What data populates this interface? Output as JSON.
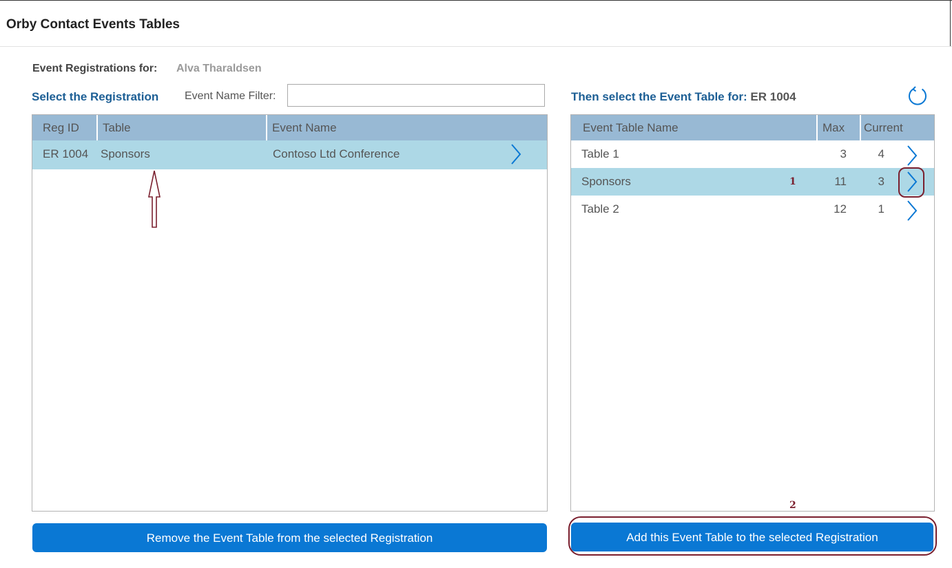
{
  "app": {
    "title": "Orby Contact Events Tables"
  },
  "registration_for": {
    "label": "Event Registrations for:",
    "contact_name": "Alva Tharaldsen"
  },
  "left_panel": {
    "heading": "Select the Registration",
    "filter": {
      "label": "Event Name Filter:",
      "value": "",
      "placeholder": ""
    },
    "columns": [
      "Reg ID",
      "Table",
      "Event Name"
    ],
    "rows": [
      {
        "reg_id": "ER 1004",
        "table": "Sponsors",
        "event_name": "Contoso Ltd Conference",
        "selected": true
      }
    ],
    "remove_button": "Remove the Event Table from the selected Registration"
  },
  "right_panel": {
    "heading_prefix": "Then select the Event Table for:",
    "heading_reg": "ER 1004",
    "columns": [
      "Event Table Name",
      "Max",
      "Current"
    ],
    "rows": [
      {
        "name": "Table 1",
        "max": "3",
        "current": "4",
        "selected": false
      },
      {
        "name": "Sponsors",
        "max": "11",
        "current": "3",
        "selected": true
      },
      {
        "name": "Table 2",
        "max": "12",
        "current": "1",
        "selected": false
      }
    ],
    "add_button": "Add this Event Table to the selected Registration"
  },
  "annotations": {
    "marker_1": "1",
    "marker_2": "2"
  },
  "colors": {
    "header_bg": "#98b9d4",
    "selected_row": "#add8e6",
    "button_blue": "#0a78d4",
    "heading_blue": "#1d5f95",
    "annotation": "#7a1f2e"
  },
  "icons": {
    "refresh": "refresh-icon",
    "row_select": "chevron-right-icon"
  }
}
